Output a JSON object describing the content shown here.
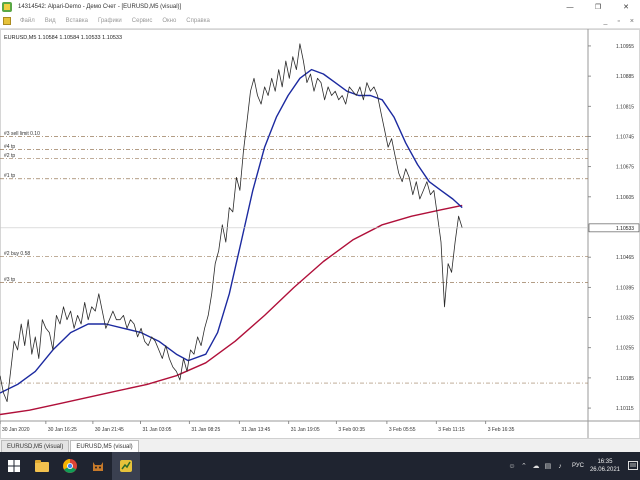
{
  "window": {
    "title": "14314542: Alpari-Demo - Демо Счет - [EURUSD,M5 (visual)]",
    "controls": {
      "minimize": "—",
      "maximize": "❐",
      "close": "✕"
    }
  },
  "menubar": {
    "items": [
      "Файл",
      "Вид",
      "Вставка",
      "Графики",
      "Сервис",
      "Окно",
      "Справка"
    ],
    "right": {
      "minimize": "_",
      "restore": "▫",
      "close": "×"
    }
  },
  "chart": {
    "info": "EURUSD,M5  1.10584  1.10584  1.10533  1.10533",
    "colors": {
      "price": "#2a2a2a",
      "fast_ma": "#1c2aa0",
      "slow_ma": "#b0103a",
      "order_line": "#9a7d5e"
    }
  },
  "chart_data": {
    "type": "line",
    "symbol": "EURUSD",
    "timeframe": "M5",
    "y_ticks": [
      1.10955,
      1.10885,
      1.10815,
      1.10745,
      1.10675,
      1.10605,
      1.10465,
      1.10395,
      1.10325,
      1.10255,
      1.10185,
      1.10115
    ],
    "current_price": 1.10533,
    "ylim": [
      1.10085,
      1.10985
    ],
    "x_ticks": [
      {
        "t": 0.0,
        "label": "30 Jan 2020"
      },
      {
        "t": 0.078,
        "label": "30 Jan 16:25"
      },
      {
        "t": 0.158,
        "label": "30 Jan 21:45"
      },
      {
        "t": 0.239,
        "label": "31 Jan 03:05"
      },
      {
        "t": 0.322,
        "label": "31 Jan 08:25"
      },
      {
        "t": 0.407,
        "label": "31 Jan 13:45"
      },
      {
        "t": 0.491,
        "label": "31 Jan 19:05"
      },
      {
        "t": 0.572,
        "label": "3 Feb 00:35"
      },
      {
        "t": 0.658,
        "label": "3 Feb 05:55"
      },
      {
        "t": 0.742,
        "label": "3 Feb 11:15"
      },
      {
        "t": 0.826,
        "label": "3 Feb 16:35"
      }
    ],
    "levels": [
      {
        "label": "#3 sell limit 0.10",
        "price": 1.10745
      },
      {
        "label": "#4 tp",
        "price": 1.10715
      },
      {
        "label": "#2 tp",
        "price": 1.10694
      },
      {
        "label": "#1 tp",
        "price": 1.10647
      },
      {
        "label": "#2 buy 0.58",
        "price": 1.10467
      },
      {
        "label": "#3 tp",
        "price": 1.10406
      },
      {
        "label": "",
        "price": 1.10173
      }
    ],
    "series": [
      {
        "kind": "price",
        "points": [
          [
            0.0,
            1.1019
          ],
          [
            0.006,
            1.1015
          ],
          [
            0.012,
            1.1013
          ],
          [
            0.018,
            1.102
          ],
          [
            0.024,
            1.1027
          ],
          [
            0.03,
            1.1025
          ],
          [
            0.036,
            1.1031
          ],
          [
            0.042,
            1.1026
          ],
          [
            0.048,
            1.1032
          ],
          [
            0.054,
            1.1024
          ],
          [
            0.06,
            1.1028
          ],
          [
            0.066,
            1.1023
          ],
          [
            0.072,
            1.1032
          ],
          [
            0.078,
            1.103
          ],
          [
            0.084,
            1.1029
          ],
          [
            0.09,
            1.1025
          ],
          [
            0.096,
            1.1033
          ],
          [
            0.102,
            1.1031
          ],
          [
            0.108,
            1.1035
          ],
          [
            0.114,
            1.1032
          ],
          [
            0.12,
            1.1034
          ],
          [
            0.126,
            1.103
          ],
          [
            0.132,
            1.1033
          ],
          [
            0.138,
            1.1031
          ],
          [
            0.144,
            1.1036
          ],
          [
            0.15,
            1.1032
          ],
          [
            0.156,
            1.1035
          ],
          [
            0.162,
            1.1034
          ],
          [
            0.168,
            1.1038
          ],
          [
            0.174,
            1.1034
          ],
          [
            0.18,
            1.103
          ],
          [
            0.186,
            1.1032
          ],
          [
            0.192,
            1.1034
          ],
          [
            0.198,
            1.1032
          ],
          [
            0.204,
            1.1032
          ],
          [
            0.21,
            1.1033
          ],
          [
            0.216,
            1.103
          ],
          [
            0.222,
            1.1032
          ],
          [
            0.228,
            1.1031
          ],
          [
            0.234,
            1.1028
          ],
          [
            0.24,
            1.103
          ],
          [
            0.246,
            1.1027
          ],
          [
            0.252,
            1.1026
          ],
          [
            0.258,
            1.1028
          ],
          [
            0.264,
            1.1027
          ],
          [
            0.27,
            1.1025
          ],
          [
            0.276,
            1.1023
          ],
          [
            0.282,
            1.1026
          ],
          [
            0.288,
            1.1023
          ],
          [
            0.294,
            1.1021
          ],
          [
            0.3,
            1.102
          ],
          [
            0.306,
            1.1018
          ],
          [
            0.312,
            1.1023
          ],
          [
            0.318,
            1.102
          ],
          [
            0.324,
            1.1025
          ],
          [
            0.33,
            1.1024
          ],
          [
            0.336,
            1.1028
          ],
          [
            0.342,
            1.1026
          ],
          [
            0.348,
            1.103
          ],
          [
            0.354,
            1.1033
          ],
          [
            0.36,
            1.1038
          ],
          [
            0.366,
            1.1045
          ],
          [
            0.372,
            1.1048
          ],
          [
            0.378,
            1.1054
          ],
          [
            0.384,
            1.105
          ],
          [
            0.39,
            1.1058
          ],
          [
            0.396,
            1.1057
          ],
          [
            0.402,
            1.1065
          ],
          [
            0.408,
            1.1062
          ],
          [
            0.414,
            1.1071
          ],
          [
            0.42,
            1.1078
          ],
          [
            0.426,
            1.1085
          ],
          [
            0.432,
            1.1088
          ],
          [
            0.438,
            1.1084
          ],
          [
            0.444,
            1.1082
          ],
          [
            0.45,
            1.1086
          ],
          [
            0.456,
            1.1084
          ],
          [
            0.462,
            1.1088
          ],
          [
            0.468,
            1.1085
          ],
          [
            0.474,
            1.109
          ],
          [
            0.48,
            1.1086
          ],
          [
            0.486,
            1.1092
          ],
          [
            0.492,
            1.1088
          ],
          [
            0.498,
            1.1093
          ],
          [
            0.504,
            1.109
          ],
          [
            0.51,
            1.1096
          ],
          [
            0.516,
            1.1092
          ],
          [
            0.522,
            1.1087
          ],
          [
            0.528,
            1.1089
          ],
          [
            0.534,
            1.1085
          ],
          [
            0.54,
            1.1088
          ],
          [
            0.546,
            1.1087
          ],
          [
            0.552,
            1.1083
          ],
          [
            0.558,
            1.1086
          ],
          [
            0.564,
            1.1084
          ],
          [
            0.57,
            1.1085
          ],
          [
            0.576,
            1.1083
          ],
          [
            0.582,
            1.1084
          ],
          [
            0.588,
            1.1082
          ],
          [
            0.594,
            1.1086
          ],
          [
            0.6,
            1.1085
          ],
          [
            0.606,
            1.1084
          ],
          [
            0.612,
            1.1086
          ],
          [
            0.618,
            1.1083
          ],
          [
            0.624,
            1.1087
          ],
          [
            0.63,
            1.1085
          ],
          [
            0.636,
            1.1086
          ],
          [
            0.642,
            1.1084
          ],
          [
            0.648,
            1.108
          ],
          [
            0.654,
            1.1076
          ],
          [
            0.66,
            1.1072
          ],
          [
            0.666,
            1.1074
          ],
          [
            0.672,
            1.107
          ],
          [
            0.678,
            1.1066
          ],
          [
            0.684,
            1.1064
          ],
          [
            0.69,
            1.1067
          ],
          [
            0.696,
            1.1065
          ],
          [
            0.702,
            1.1061
          ],
          [
            0.708,
            1.1064
          ],
          [
            0.714,
            1.106
          ],
          [
            0.72,
            1.1062
          ],
          [
            0.726,
            1.1064
          ],
          [
            0.732,
            1.1061
          ],
          [
            0.738,
            1.1062
          ],
          [
            0.744,
            1.1056
          ],
          [
            0.75,
            1.105
          ],
          [
            0.756,
            1.1035
          ],
          [
            0.762,
            1.1045
          ],
          [
            0.768,
            1.1043
          ],
          [
            0.774,
            1.105
          ],
          [
            0.78,
            1.1056
          ],
          [
            0.786,
            1.10533
          ]
        ]
      },
      {
        "kind": "fast_ma",
        "points": [
          [
            0.0,
            1.1015
          ],
          [
            0.03,
            1.1017
          ],
          [
            0.06,
            1.102
          ],
          [
            0.09,
            1.1025
          ],
          [
            0.12,
            1.1029
          ],
          [
            0.15,
            1.1031
          ],
          [
            0.18,
            1.1031
          ],
          [
            0.21,
            1.103
          ],
          [
            0.24,
            1.1029
          ],
          [
            0.27,
            1.1027
          ],
          [
            0.3,
            1.1024
          ],
          [
            0.32,
            1.10225
          ],
          [
            0.35,
            1.1024
          ],
          [
            0.37,
            1.1029
          ],
          [
            0.39,
            1.1038
          ],
          [
            0.41,
            1.105
          ],
          [
            0.43,
            1.1062
          ],
          [
            0.45,
            1.1072
          ],
          [
            0.47,
            1.1079
          ],
          [
            0.49,
            1.1084
          ],
          [
            0.51,
            1.1088
          ],
          [
            0.53,
            1.109
          ],
          [
            0.55,
            1.1089
          ],
          [
            0.57,
            1.1087
          ],
          [
            0.59,
            1.1085
          ],
          [
            0.61,
            1.1084
          ],
          [
            0.63,
            1.1084
          ],
          [
            0.65,
            1.1083
          ],
          [
            0.67,
            1.1079
          ],
          [
            0.69,
            1.1073
          ],
          [
            0.71,
            1.1068
          ],
          [
            0.73,
            1.1064
          ],
          [
            0.75,
            1.1062
          ],
          [
            0.77,
            1.106
          ],
          [
            0.786,
            1.1058
          ]
        ]
      },
      {
        "kind": "slow_ma",
        "points": [
          [
            0.0,
            1.101
          ],
          [
            0.05,
            1.1011
          ],
          [
            0.1,
            1.10125
          ],
          [
            0.15,
            1.1014
          ],
          [
            0.2,
            1.10155
          ],
          [
            0.25,
            1.1017
          ],
          [
            0.3,
            1.1019
          ],
          [
            0.35,
            1.1022
          ],
          [
            0.4,
            1.1027
          ],
          [
            0.45,
            1.1033
          ],
          [
            0.5,
            1.10395
          ],
          [
            0.55,
            1.10455
          ],
          [
            0.6,
            1.10505
          ],
          [
            0.65,
            1.1054
          ],
          [
            0.7,
            1.1056
          ],
          [
            0.75,
            1.10575
          ],
          [
            0.786,
            1.10585
          ]
        ]
      }
    ]
  },
  "tabs": [
    {
      "label": "EURUSD,M5 (visual)",
      "active": false
    },
    {
      "label": "EURUSD,M5 (visual)",
      "active": true
    }
  ],
  "taskbar": {
    "apps": [
      "windows-logo",
      "file-explorer",
      "chrome",
      "cat-game",
      "metatrader"
    ],
    "tray": {
      "lang": "РУС",
      "time": "16:35",
      "date": "26.06.2021"
    }
  }
}
